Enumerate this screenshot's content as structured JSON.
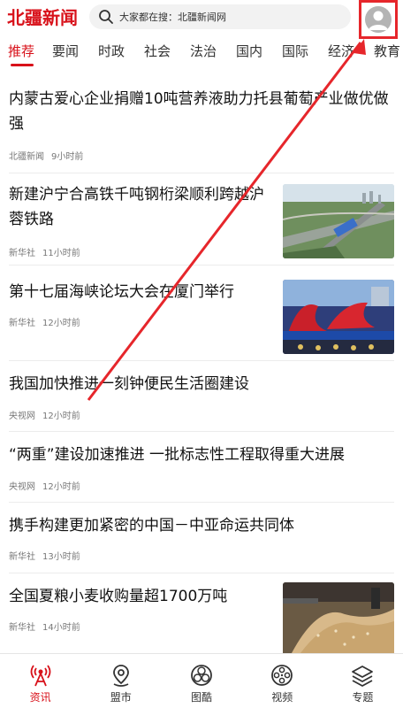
{
  "header": {
    "logo_text": "北疆新闻",
    "search_placeholder": "大家都在搜：北疆新闻网"
  },
  "tabs": [
    {
      "label": "推荐",
      "active": true
    },
    {
      "label": "要闻"
    },
    {
      "label": "时政"
    },
    {
      "label": "社会"
    },
    {
      "label": "法治"
    },
    {
      "label": "国内"
    },
    {
      "label": "国际"
    },
    {
      "label": "经济"
    },
    {
      "label": "教育"
    }
  ],
  "news": [
    {
      "title": "内蒙古爱心企业捐赠10吨营养液助力托县葡萄产业做优做强",
      "source": "北疆新闻",
      "time": "9小时前"
    },
    {
      "title": "新建沪宁合高铁千吨钢桁梁顺利跨越沪蓉铁路",
      "source": "新华社",
      "time": "11小时前"
    },
    {
      "title": "第十七届海峡论坛大会在厦门举行",
      "source": "新华社",
      "time": "12小时前"
    },
    {
      "title": "我国加快推进一刻钟便民生活圈建设",
      "source": "央视网",
      "time": "12小时前"
    },
    {
      "title": "“两重”建设加速推进 一批标志性工程取得重大进展",
      "source": "央视网",
      "time": "12小时前"
    },
    {
      "title": "携手构建更加紧密的中国－中亚命运共同体",
      "source": "新华社",
      "time": "13小时前"
    },
    {
      "title": "全国夏粮小麦收购量超1700万吨",
      "source": "新华社",
      "time": "14小时前"
    }
  ],
  "tabbar": [
    {
      "label": "资讯",
      "icon": "broadcast-icon",
      "active": true
    },
    {
      "label": "盟市",
      "icon": "map-pin-icon"
    },
    {
      "label": "图酷",
      "icon": "camera-lens-icon"
    },
    {
      "label": "视频",
      "icon": "film-reel-icon"
    },
    {
      "label": "专题",
      "icon": "layers-icon"
    }
  ],
  "colors": {
    "brand_red": "#d8111a",
    "annotation_red": "#e6262b"
  }
}
